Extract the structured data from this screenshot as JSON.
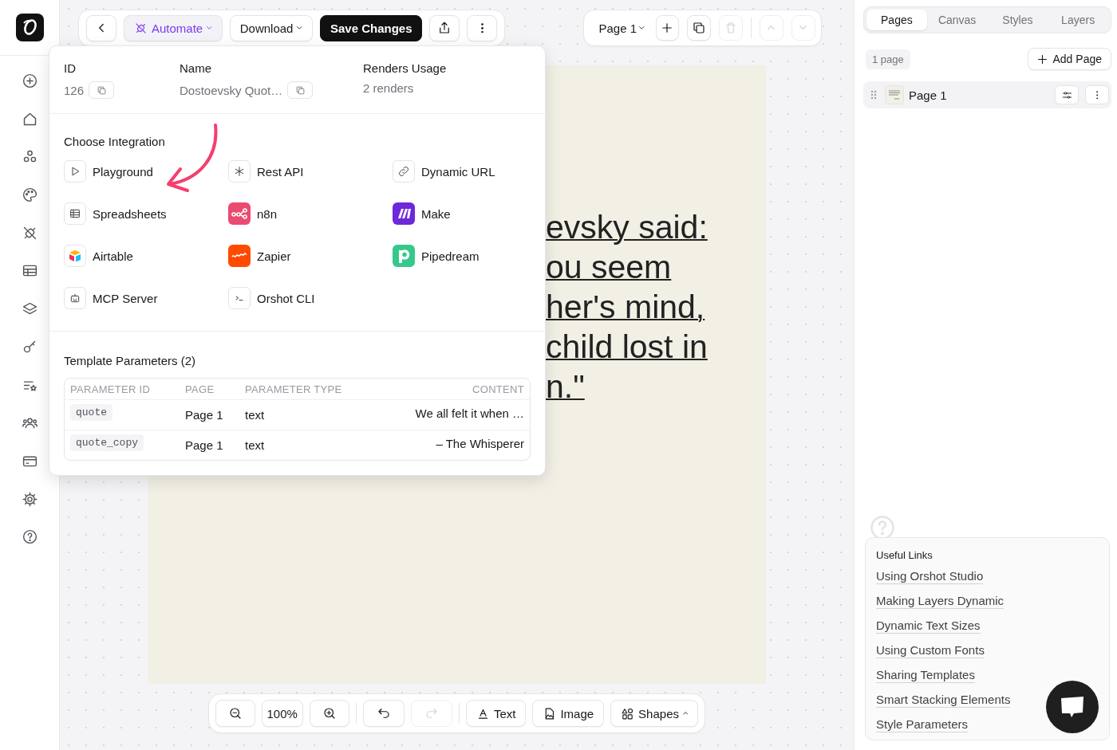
{
  "top_toolbar": [
    {
      "kind": "icon"
    },
    {
      "kind": "menu",
      "label": "Automate",
      "selected": true
    },
    {
      "kind": "menu",
      "label": "Download",
      "selected": false
    },
    {
      "kind": "primary",
      "label": "Save Changes"
    },
    {
      "kind": "icon"
    },
    {
      "kind": "icon"
    }
  ],
  "page_toolbar": {
    "page_select": "Page 1",
    "buttons": [
      {
        "disabled": false
      },
      {
        "disabled": false
      },
      {
        "disabled": true
      },
      {
        "disabled": true
      },
      {
        "disabled": true
      }
    ]
  },
  "integration_popover": {
    "info": [
      {
        "label": "ID",
        "value": "126",
        "copyable": true
      },
      {
        "label": "Name",
        "value": "Dostoevsky Quot…",
        "copyable": true
      },
      {
        "label": "Renders Usage",
        "value": "2 renders",
        "copyable": false
      }
    ],
    "integration_title": "Choose Integration",
    "integrations": [
      {
        "label": "Playground"
      },
      {
        "label": "Rest API"
      },
      {
        "label": "Dynamic URL"
      },
      {
        "label": "Spreadsheets"
      },
      {
        "label": "n8n"
      },
      {
        "label": "Make"
      },
      {
        "label": "Airtable"
      },
      {
        "label": "Zapier"
      },
      {
        "label": "Pipedream"
      },
      {
        "label": "MCP Server"
      },
      {
        "label": "Orshot CLI"
      }
    ],
    "parameters_title": "Template Parameters (2)",
    "parameters_table": {
      "columns": [
        "PARAMETER ID",
        "PAGE",
        "PARAMETER TYPE",
        "CONTENT"
      ],
      "rows": [
        {
          "cells": [
            "quote",
            "Page 1",
            "text",
            "We all felt it when …"
          ]
        },
        {
          "cells": [
            "quote_copy",
            "Page 1",
            "text",
            "– The Whisperer"
          ]
        }
      ]
    }
  },
  "canvas_page": {
    "text_lines": [
      "evsky said:",
      "ou seem",
      "her's mind,",
      "child lost in",
      "n.\""
    ]
  },
  "bottom_toolbar": [
    {
      "kind": "icon",
      "disabled": false
    },
    {
      "kind": "text",
      "label": "100%",
      "disabled": false
    },
    {
      "kind": "icon",
      "disabled": false
    },
    {
      "kind": "separator"
    },
    {
      "kind": "icon",
      "disabled": false
    },
    {
      "kind": "icon",
      "disabled": true
    },
    {
      "kind": "separator"
    },
    {
      "kind": "tool",
      "label": "Text",
      "disabled": false
    },
    {
      "kind": "tool",
      "label": "Image",
      "disabled": false
    },
    {
      "kind": "tool",
      "label": "Shapes",
      "disabled": false
    }
  ],
  "side_panel": {
    "tabs": [
      {
        "label": "Pages",
        "selected": true
      },
      {
        "label": "Canvas",
        "selected": false
      },
      {
        "label": "Styles",
        "selected": false
      },
      {
        "label": "Layers",
        "selected": false
      }
    ],
    "page_count": "1 page",
    "add_button": "Add Page",
    "pages": [
      {
        "label": "Page 1"
      }
    ],
    "useful_links": {
      "title": "Useful Links",
      "links": [
        "Using Orshot Studio",
        "Making Layers Dynamic",
        "Dynamic Text Sizes",
        "Using Custom Fonts",
        "Sharing Templates",
        "Smart Stacking Elements",
        "Style Parameters"
      ]
    }
  }
}
